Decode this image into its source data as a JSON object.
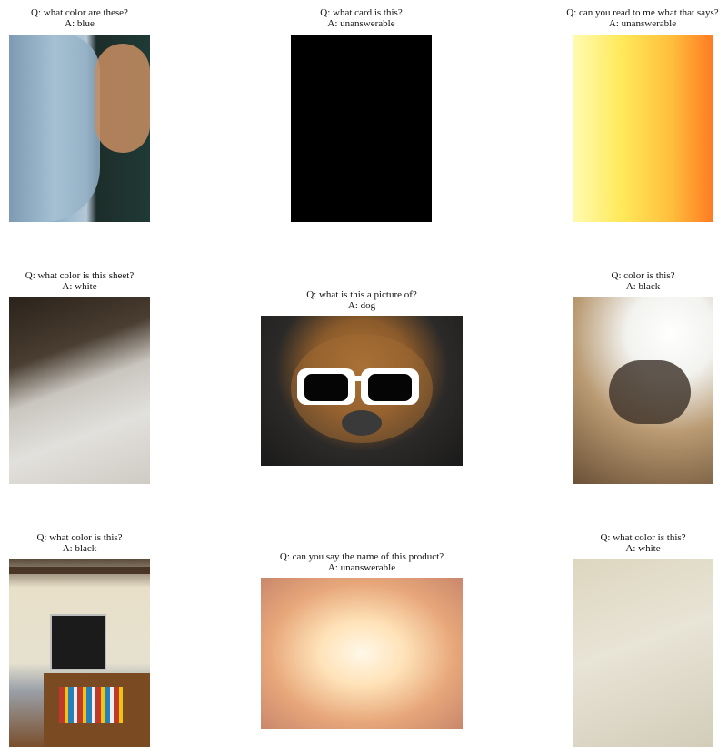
{
  "items": [
    {
      "question": "Q: what color are these?",
      "answer": "A: blue"
    },
    {
      "question": "Q: what card is this?",
      "answer": "A: unanswerable"
    },
    {
      "question": "Q: can you read to me what that says?",
      "answer": "A: unanswerable"
    },
    {
      "question": "Q: what color is this sheet?",
      "answer": "A: white"
    },
    {
      "question": "Q: what is this a picture of?",
      "answer": "A: dog"
    },
    {
      "question": "Q: color is this?",
      "answer": "A: black"
    },
    {
      "question": "Q: what color is this?",
      "answer": "A: black"
    },
    {
      "question": "Q: can you say the name of this product?",
      "answer": "A: unanswerable"
    },
    {
      "question": "Q: what color is this?",
      "answer": "A: white"
    }
  ]
}
